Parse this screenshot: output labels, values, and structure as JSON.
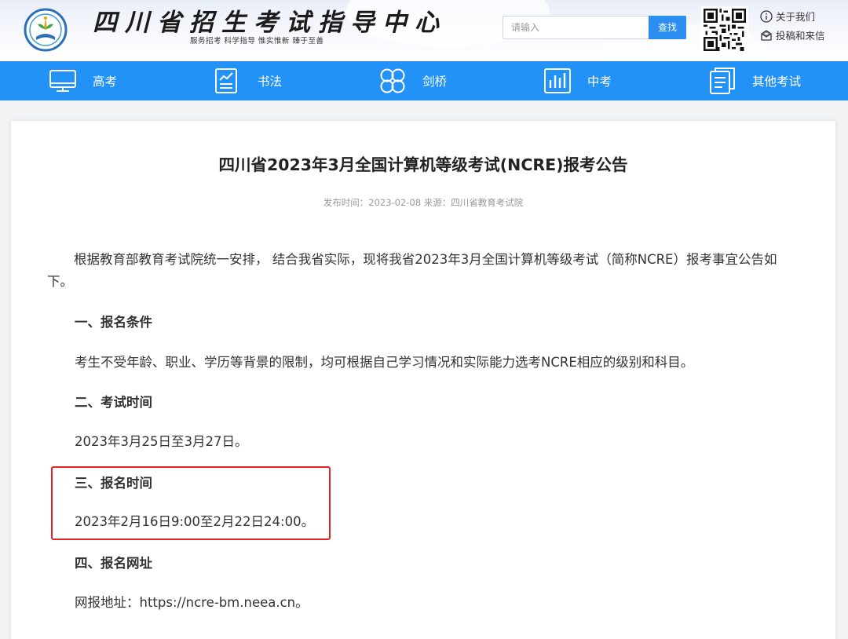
{
  "header": {
    "site_title": "四川省招生考试指导中心",
    "slogan": "服务招考  科学指导  惟实惟新  臻于至善",
    "search": {
      "placeholder": "请输入",
      "button_label": "查找"
    },
    "links": [
      {
        "label": "关于我们",
        "icon": "info-icon"
      },
      {
        "label": "投稿和来信",
        "icon": "mail-icon"
      }
    ],
    "brand_color": "#2392f6"
  },
  "nav": {
    "items": [
      {
        "label": "高考",
        "icon": "monitor-icon"
      },
      {
        "label": "书法",
        "icon": "document-chart-icon"
      },
      {
        "label": "剑桥",
        "icon": "clover-icon"
      },
      {
        "label": "中考",
        "icon": "bar-chart-icon"
      },
      {
        "label": "其他考试",
        "icon": "document-list-icon"
      }
    ]
  },
  "article": {
    "title": "四川省2023年3月全国计算机等级考试(NCRE)报考公告",
    "meta": "发布时间：2023-02-08   来源：四川省教育考试院",
    "intro": "根据教育部教育考试院统一安排， 结合我省实际，现将我省2023年3月全国计算机等级考试（简称NCRE）报考事宜公告如下。",
    "sections": [
      {
        "heading": "一、报名条件",
        "body": "考生不受年龄、职业、学历等背景的限制，均可根据自己学习情况和实际能力选考NCRE相应的级别和科目。"
      },
      {
        "heading": "二、考试时间",
        "body": "2023年3月25日至3月27日。"
      },
      {
        "heading": "三、报名时间",
        "body": "2023年2月16日9:00至2月22日24:00。"
      },
      {
        "heading": "四、报名网址",
        "body": "网报地址：https://ncre-bm.neea.cn。"
      }
    ],
    "highlight_color": "#e02424"
  }
}
